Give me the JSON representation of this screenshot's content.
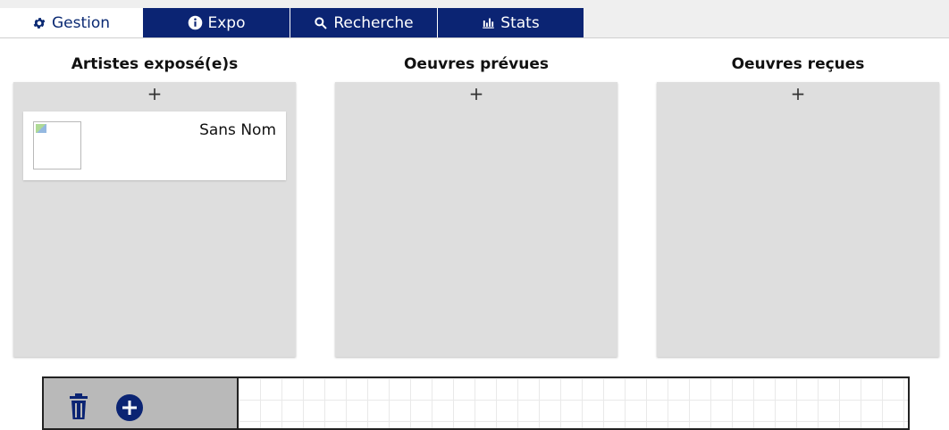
{
  "tabs": [
    {
      "label": "Gestion",
      "icon": "gear-icon",
      "active": true
    },
    {
      "label": "Expo",
      "icon": "info-icon",
      "active": false
    },
    {
      "label": "Recherche",
      "icon": "search-icon",
      "active": false
    },
    {
      "label": "Stats",
      "icon": "stats-icon",
      "active": false
    }
  ],
  "columns": [
    {
      "title": "Artistes exposé(e)s",
      "add_label": "+",
      "cards": [
        {
          "name": "Sans Nom"
        }
      ]
    },
    {
      "title": "Oeuvres prévues",
      "add_label": "+",
      "cards": []
    },
    {
      "title": "Oeuvres reçues",
      "add_label": "+",
      "cards": []
    }
  ],
  "bottom_panel": {
    "tools": [
      "trash-icon",
      "plus-circle-icon"
    ]
  },
  "colors": {
    "accent": "#0b2473",
    "panel_bg": "#dedede"
  }
}
